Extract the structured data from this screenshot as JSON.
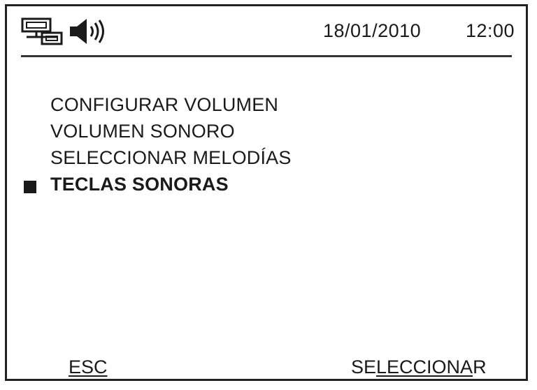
{
  "status_bar": {
    "network_icon": "network-icon",
    "speaker_icon": "speaker-icon",
    "date": "18/01/2010",
    "time": "12:00"
  },
  "menu": {
    "items": [
      {
        "label": "CONFIGURAR VOLUMEN",
        "selected": false
      },
      {
        "label": "VOLUMEN SONORO",
        "selected": false
      },
      {
        "label": "SELECCIONAR MELODÍAS",
        "selected": false
      },
      {
        "label": "TECLAS SONORAS",
        "selected": true
      }
    ]
  },
  "softkeys": {
    "left_label": "ESC",
    "right_label_prefix": "SE",
    "right_label_underlined": "LECCIONA",
    "right_label_suffix": "R"
  }
}
